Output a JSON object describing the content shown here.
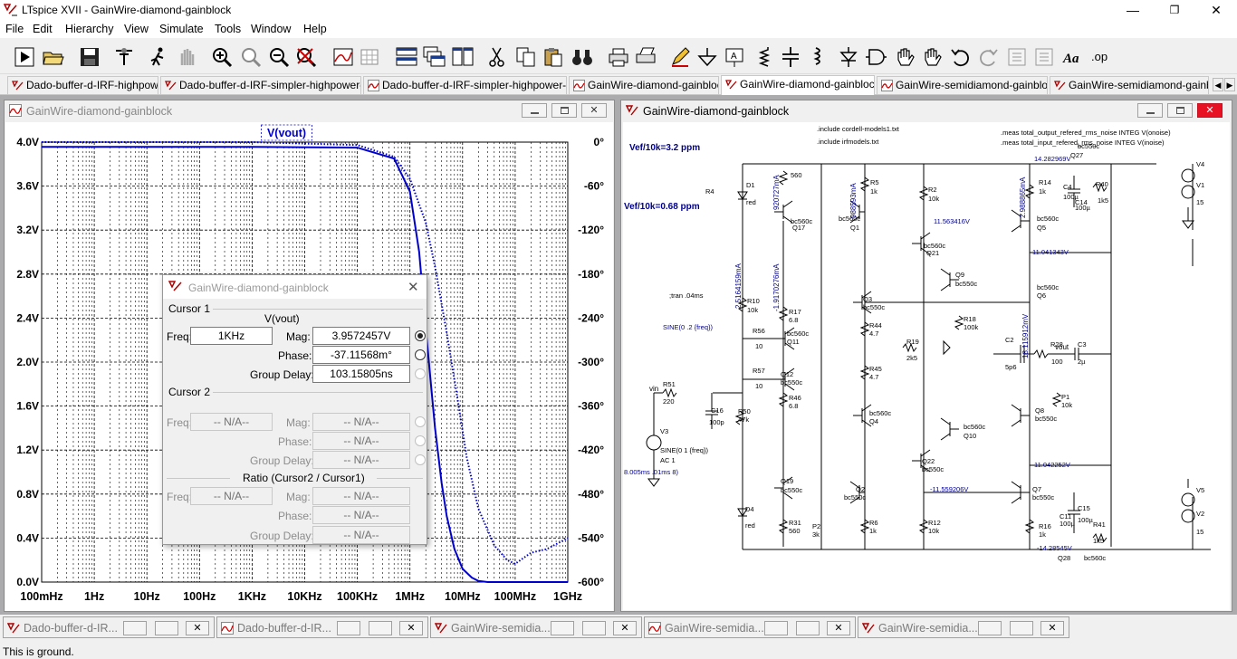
{
  "app": {
    "title": "LTspice XVII - GainWire-diamond-gainblock",
    "controls": {
      "minimize": "—",
      "restore": "❐",
      "close": "✕"
    }
  },
  "menu": [
    "File",
    "Edit",
    "Hierarchy",
    "View",
    "Simulate",
    "Tools",
    "Window",
    "Help"
  ],
  "tabs": [
    {
      "label": "Dado-buffer-d-IRF-highpower",
      "kind": "schematic"
    },
    {
      "label": "Dado-buffer-d-IRF-simpler-highpower-3W",
      "kind": "schematic"
    },
    {
      "label": "Dado-buffer-d-IRF-simpler-highpower-3W",
      "kind": "waveform"
    },
    {
      "label": "GainWire-diamond-gainblock",
      "kind": "waveform"
    },
    {
      "label": "GainWire-diamond-gainblock",
      "kind": "schematic",
      "active": true
    },
    {
      "label": "GainWire-semidiamond-gainblock",
      "kind": "waveform"
    },
    {
      "label": "GainWire-semidiamond-gainblo",
      "kind": "schematic"
    }
  ],
  "plot_window": {
    "title": "GainWire-diamond-gainblock",
    "trace_label": "V(vout)"
  },
  "chart_data": {
    "type": "line",
    "title": "",
    "trace": "V(vout)",
    "x_scale": "log",
    "x_ticks": [
      "100mHz",
      "1Hz",
      "10Hz",
      "100Hz",
      "1KHz",
      "10KHz",
      "100KHz",
      "1MHz",
      "10MHz",
      "100MHz",
      "1GHz"
    ],
    "x_range_hz": [
      0.1,
      1000000000
    ],
    "y_left_ticks": [
      "4.0V",
      "3.6V",
      "3.2V",
      "2.8V",
      "2.4V",
      "2.0V",
      "1.6V",
      "1.2V",
      "0.8V",
      "0.4V",
      "0.0V"
    ],
    "y_left_range": [
      0.0,
      4.0
    ],
    "y_right_ticks": [
      "0°",
      "-60°",
      "-120°",
      "-180°",
      "-240°",
      "-300°",
      "-360°",
      "-420°",
      "-480°",
      "-540°",
      "-600°"
    ],
    "y_right_range": [
      -600,
      0
    ],
    "grid": true,
    "series": [
      {
        "name": "magnitude",
        "axis": "left",
        "style": "solid",
        "points": [
          [
            0.1,
            3.957
          ],
          [
            1,
            3.957
          ],
          [
            1000,
            3.957
          ],
          [
            100000,
            3.95
          ],
          [
            500000,
            3.85
          ],
          [
            1000000,
            3.55
          ],
          [
            1500000,
            3.0
          ],
          [
            2000000,
            2.3
          ],
          [
            3000000,
            1.4
          ],
          [
            4000000,
            0.9
          ],
          [
            5000000,
            0.6
          ],
          [
            7000000,
            0.3
          ],
          [
            10000000,
            0.12
          ],
          [
            15000000,
            0.04
          ],
          [
            20000000,
            0.01
          ],
          [
            30000000,
            0.0
          ],
          [
            1000000000,
            0.0
          ]
        ]
      },
      {
        "name": "phase",
        "axis": "right",
        "style": "dotted",
        "points": [
          [
            0.1,
            0
          ],
          [
            1000,
            -0.04
          ],
          [
            100000,
            -4
          ],
          [
            500000,
            -20
          ],
          [
            1000000,
            -50
          ],
          [
            2000000,
            -110
          ],
          [
            3000000,
            -170
          ],
          [
            5000000,
            -260
          ],
          [
            8000000,
            -350
          ],
          [
            12000000,
            -430
          ],
          [
            20000000,
            -500
          ],
          [
            40000000,
            -550
          ],
          [
            70000000,
            -570
          ],
          [
            100000000,
            -575
          ],
          [
            200000000,
            -560
          ],
          [
            400000000,
            -555
          ],
          [
            1000000000,
            -540
          ]
        ]
      }
    ]
  },
  "cursor_dialog": {
    "title": "GainWire-diamond-gainblock",
    "cursor1": {
      "group_label": "Cursor 1",
      "trace": "V(vout)",
      "freq_label": "Freq:",
      "freq": "1KHz",
      "mag_label": "Mag:",
      "mag": "3.9572457V",
      "phase_label": "Phase:",
      "phase": "-37.11568m°",
      "gd_label": "Group Delay:",
      "gd": "103.15805ns"
    },
    "cursor2": {
      "group_label": "Cursor 2",
      "freq_label": "Freq:",
      "freq": "-- N/A--",
      "mag_label": "Mag:",
      "mag": "-- N/A--",
      "phase_label": "Phase:",
      "phase": "-- N/A--",
      "gd_label": "Group Delay:",
      "gd": "-- N/A--"
    },
    "ratio": {
      "group_label": "Ratio (Cursor2 / Cursor1)",
      "freq_label": "Freq:",
      "freq": "-- N/A--",
      "mag_label": "Mag:",
      "mag": "-- N/A--",
      "phase_label": "Phase:",
      "phase": "-- N/A--",
      "gd_label": "Group Delay:",
      "gd": "-- N/A--"
    }
  },
  "schematic_window": {
    "title": "GainWire-diamond-gainblock",
    "directives": {
      "inc1": ".include cordell-models1.txt",
      "inc2": ".include irfmodels.txt",
      "meas1": ".meas total_output_refered_rms_noise INTEG V(onoise)",
      "meas2": ".meas total_input_refered_rms_noise INTEG V(inoise)",
      "tran": ";tran .04ms",
      "vef1": "Vef/10k=3.2 ppm",
      "vef2": "Vef/10k=0.68 ppm",
      "sine1": "SINE(0 .2 {freq})",
      "sine2": "SINE(0 1 {freq})",
      "ac": "AC 1",
      "time": "8.005ms .01ms 8)",
      "vin": "vin",
      "vout": "vout"
    },
    "labels": [
      "R4",
      "560",
      "D1",
      "red",
      "Q17",
      "bc560c",
      "R5",
      "1k",
      "R2",
      "10k",
      "bc560c",
      "Q1",
      "11.563416V",
      "bc560c",
      "Q5",
      "R14",
      "1k",
      "C4",
      "100µ",
      "C14",
      "100µ",
      "R40",
      "1k5",
      "V4",
      "V1",
      "15",
      "bc560c",
      "Q21",
      "Q9",
      "bc550c",
      "11.041343V",
      "bc560c",
      "Q6",
      "R10",
      "10k",
      "Q3",
      "bc550c",
      "R17",
      "6.8",
      "R44",
      "4.7",
      "R18",
      "100k",
      "C2",
      "5p6",
      "R28",
      "100",
      "C3",
      "2µ",
      "R56",
      "10",
      "bc560c",
      "Q11",
      "R19",
      "2k5",
      "R57",
      "10",
      "Q12",
      "bc550c",
      "R45",
      "4.7",
      "R51",
      "220",
      "C16",
      "100p",
      "R50",
      "47k",
      "R46",
      "6.8",
      "Q4",
      "bc560c",
      "P1",
      "10k",
      "Q8",
      "bc550c",
      "V3",
      "bc560c",
      "Q10",
      "Q22",
      "bc550c",
      "11.042252V",
      "Q19",
      "bc550c",
      "Q2",
      "bc550c",
      "-11.559206V",
      "Q7",
      "bc550c",
      "C15",
      "100µ",
      "C11",
      "100µ",
      "V5",
      "V2",
      "15",
      "D4",
      "red",
      "R31",
      "560",
      "P2",
      "3k",
      "R6",
      "1k",
      "R12",
      "10k",
      "R16",
      "1k",
      "R41",
      "1k5",
      "-14.28545V",
      "Q28",
      "bc560c",
      "14.282969V",
      "Q27",
      "bc550c"
    ],
    "currents": [
      "2.5164159mA",
      "920727mA",
      "-1.9170276mA",
      "988593mA",
      "2.988865mA",
      "18.115912mV"
    ]
  },
  "minimized": [
    {
      "label": "Dado-buffer-d-IR...",
      "kind": "schematic"
    },
    {
      "label": "Dado-buffer-d-IR...",
      "kind": "waveform"
    },
    {
      "label": "GainWire-semidia...",
      "kind": "schematic"
    },
    {
      "label": "GainWire-semidia...",
      "kind": "waveform"
    },
    {
      "label": "GainWire-semidia...",
      "kind": "schematic"
    }
  ],
  "status": "This is ground."
}
